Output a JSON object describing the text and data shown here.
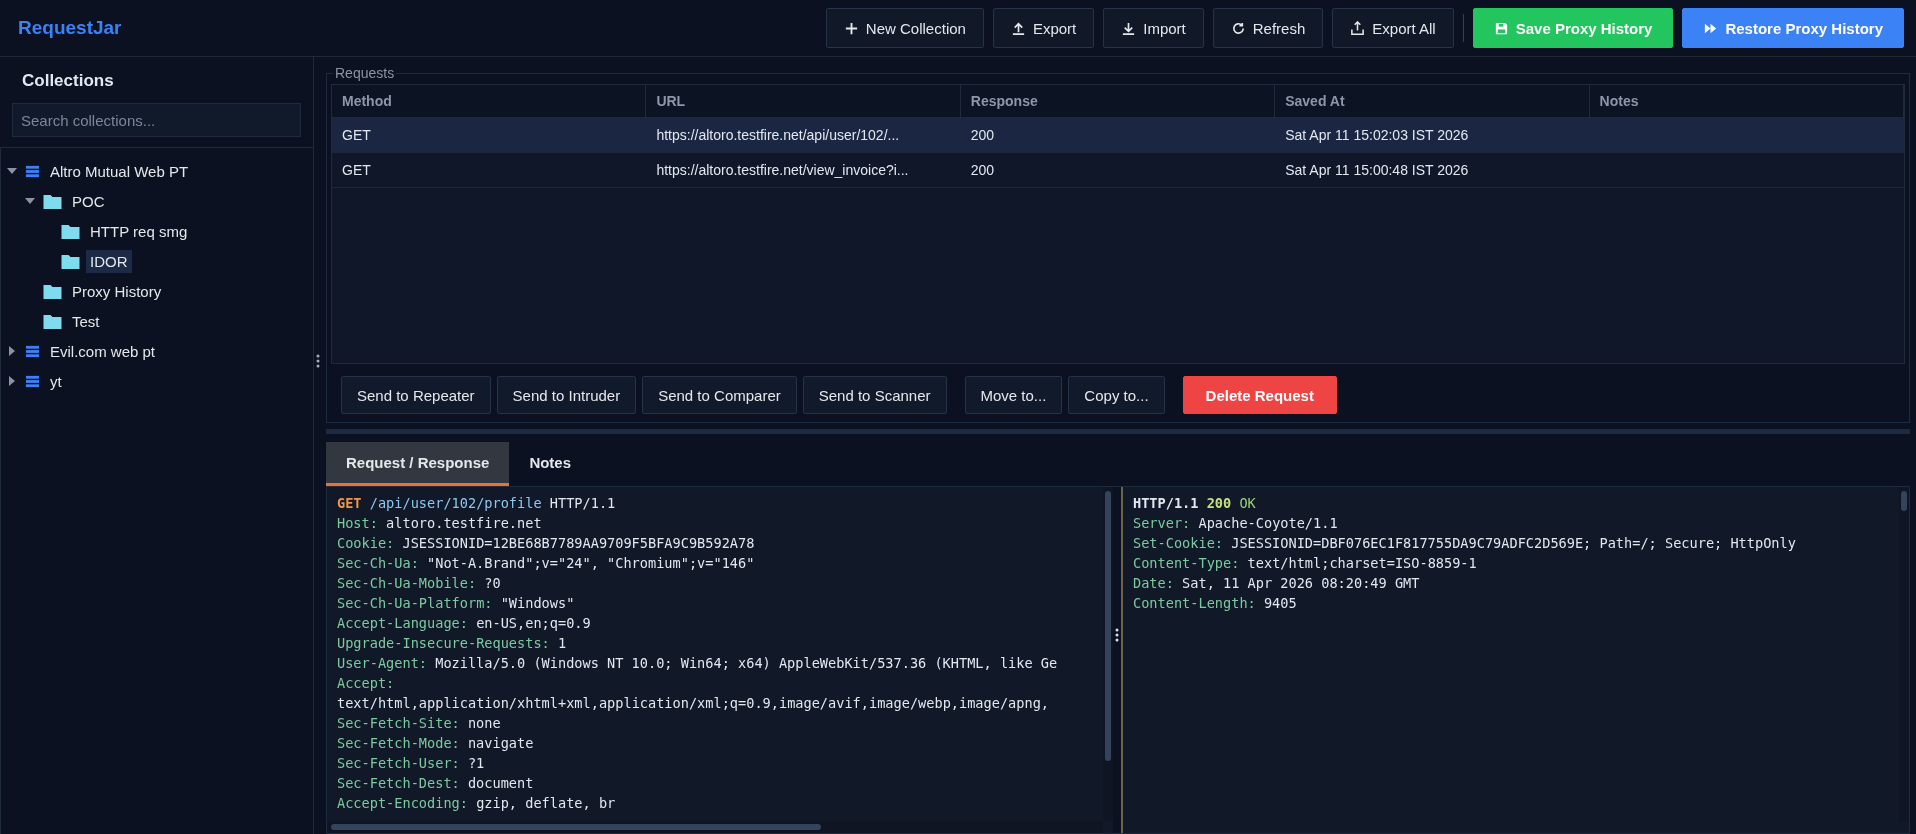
{
  "app": {
    "title": "RequestJar"
  },
  "toolbar": [
    {
      "label": "New Collection",
      "kind": "plain"
    },
    {
      "label": "Export",
      "kind": "plain"
    },
    {
      "label": "Import",
      "kind": "plain"
    },
    {
      "label": "Refresh",
      "kind": "plain"
    },
    {
      "label": "Export All",
      "kind": "plain"
    },
    {
      "label": "Save Proxy History",
      "kind": "success"
    },
    {
      "label": "Restore Proxy History",
      "kind": "primary"
    }
  ],
  "sidebar": {
    "title": "Collections",
    "search": {
      "placeholder": "Search collections..."
    },
    "tree": [
      {
        "label": "Altro Mutual Web PT",
        "kind": "collection",
        "expanded": true,
        "selected": false,
        "children": [
          {
            "label": "POC",
            "kind": "folder",
            "expanded": true,
            "selected": false,
            "children": [
              {
                "label": "HTTP req smg",
                "kind": "folder",
                "selected": false
              },
              {
                "label": "IDOR",
                "kind": "folder",
                "selected": true
              }
            ]
          },
          {
            "label": "Proxy History",
            "kind": "folder",
            "selected": false
          },
          {
            "label": "Test",
            "kind": "folder",
            "selected": false
          }
        ]
      },
      {
        "label": "Evil.com web pt",
        "kind": "collection",
        "expanded": false,
        "selected": false
      },
      {
        "label": "yt",
        "kind": "collection",
        "expanded": false,
        "selected": false
      }
    ]
  },
  "requests": {
    "title": "Requests",
    "columns": [
      "Method",
      "URL",
      "Response",
      "Saved At",
      "Notes"
    ],
    "rows": [
      {
        "cells": [
          "GET",
          "https://altoro.testfire.net/api/user/102/...",
          "200",
          "Sat Apr 11 15:02:03 IST 2026"
        ],
        "selected": true
      },
      {
        "cells": [
          "GET",
          "https://altoro.testfire.net/view_invoice?i...",
          "200",
          "Sat Apr 11 15:00:48 IST 2026"
        ],
        "selected": false
      }
    ],
    "action_groups": [
      [
        {
          "label": "Send to Repeater",
          "kind": "plain"
        },
        {
          "label": "Send to Intruder",
          "kind": "plain"
        },
        {
          "label": "Send to Comparer",
          "kind": "plain"
        },
        {
          "label": "Send to Scanner",
          "kind": "plain"
        }
      ],
      [
        {
          "label": "Move to...",
          "kind": "plain"
        },
        {
          "label": "Copy to...",
          "kind": "plain"
        }
      ],
      [
        {
          "label": "Delete Request",
          "kind": "danger"
        }
      ]
    ]
  },
  "tabs": [
    {
      "label": "Request / Response",
      "selected": true
    },
    {
      "label": "Notes",
      "selected": false
    }
  ],
  "request": [
    {
      "kind": "request",
      "method": "GET",
      "path": "/api/user/102/profile",
      "version": "HTTP/1.1"
    },
    {
      "kind": "header",
      "name": "Host:",
      "value": "altoro.testfire.net"
    },
    {
      "kind": "header",
      "name": "Cookie:",
      "value": "JSESSIONID=12BE68B7789AA9709F5BFA9C9B592A78"
    },
    {
      "kind": "header",
      "name": "Sec-Ch-Ua:",
      "value": "\"Not-A.Brand\";v=\"24\", \"Chromium\";v=\"146\""
    },
    {
      "kind": "header",
      "name": "Sec-Ch-Ua-Mobile:",
      "value": "?0"
    },
    {
      "kind": "header",
      "name": "Sec-Ch-Ua-Platform:",
      "value": "\"Windows\""
    },
    {
      "kind": "header",
      "name": "Accept-Language:",
      "value": "en-US,en;q=0.9"
    },
    {
      "kind": "header",
      "name": "Upgrade-Insecure-Requests:",
      "value": "1"
    },
    {
      "kind": "header",
      "name": "User-Agent:",
      "value": "Mozilla/5.0 (Windows NT 10.0; Win64; x64) AppleWebKit/537.36 (KHTML, like Ge"
    },
    {
      "kind": "header",
      "name": "Accept:"
    },
    {
      "kind": "text",
      "value": "text/html,application/xhtml+xml,application/xml;q=0.9,image/avif,image/webp,image/apng,"
    },
    {
      "kind": "header",
      "name": "Sec-Fetch-Site:",
      "value": "none"
    },
    {
      "kind": "header",
      "name": "Sec-Fetch-Mode:",
      "value": "navigate"
    },
    {
      "kind": "header",
      "name": "Sec-Fetch-User:",
      "value": "?1"
    },
    {
      "kind": "header",
      "name": "Sec-Fetch-Dest:",
      "value": "document"
    },
    {
      "kind": "header",
      "name": "Accept-Encoding:",
      "value": "gzip, deflate, br"
    }
  ],
  "response": [
    {
      "kind": "status",
      "version": "HTTP/1.1",
      "code": "200",
      "reason": "OK"
    },
    {
      "kind": "header",
      "name": "Server:",
      "value": "Apache-Coyote/1.1"
    },
    {
      "kind": "header",
      "name": "Set-Cookie:",
      "value": "JSESSIONID=DBF076EC1F817755DA9C79ADFC2D569E; Path=/; Secure; HttpOnly"
    },
    {
      "kind": "header",
      "name": "Content-Type:",
      "value": "text/html;charset=ISO-8859-1"
    },
    {
      "kind": "header",
      "name": "Date:",
      "value": "Sat, 11 Apr 2026 08:20:49 GMT"
    },
    {
      "kind": "header",
      "name": "Content-Length:",
      "value": "9405"
    }
  ]
}
